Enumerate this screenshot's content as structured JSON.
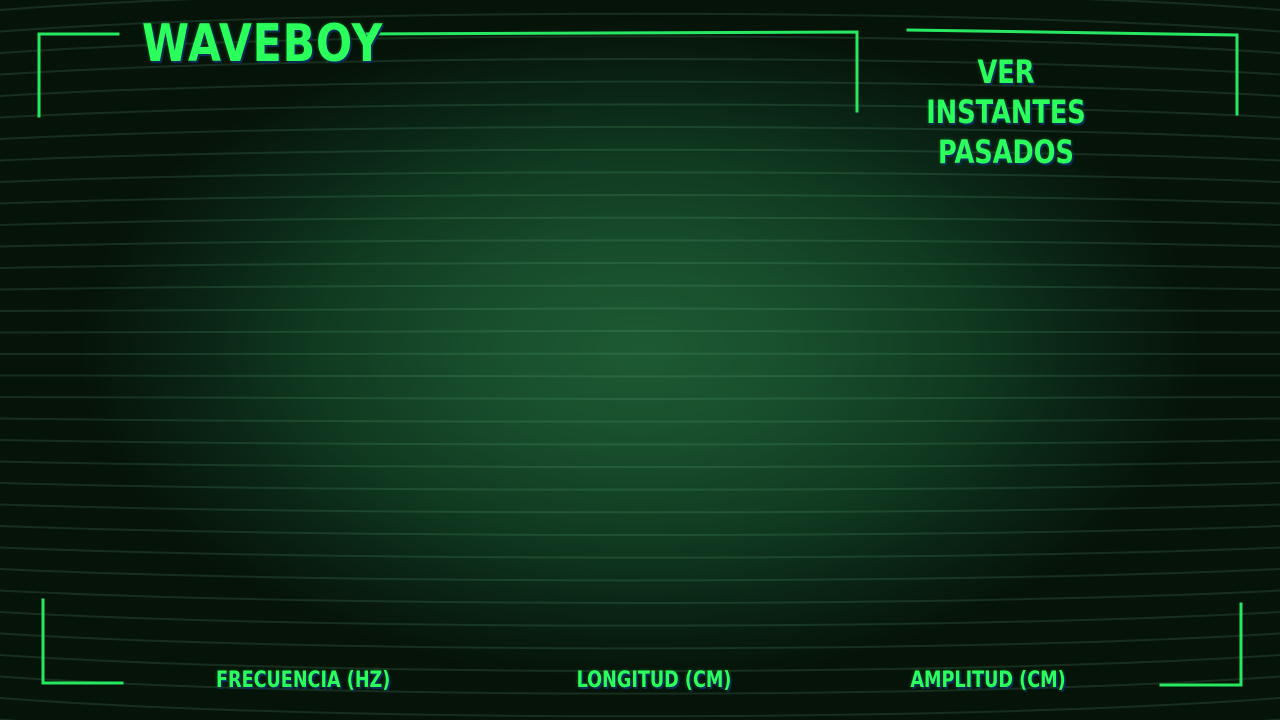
{
  "game": {
    "title": "WAVEBOY"
  },
  "menu": {
    "past_button_line1": "VER INSTANTES",
    "past_button_line2": "PASADOS"
  },
  "parameters": {
    "frequency_label": "FRECUENCIA (HZ)",
    "length_label": "LONGITUD (CM)",
    "amplitude_label": "AMPLITUD (CM)"
  },
  "colors": {
    "accent": "#2bff5c",
    "frame": "#27e860",
    "background_center": "#1d5a33",
    "background_edge": "#061309"
  }
}
